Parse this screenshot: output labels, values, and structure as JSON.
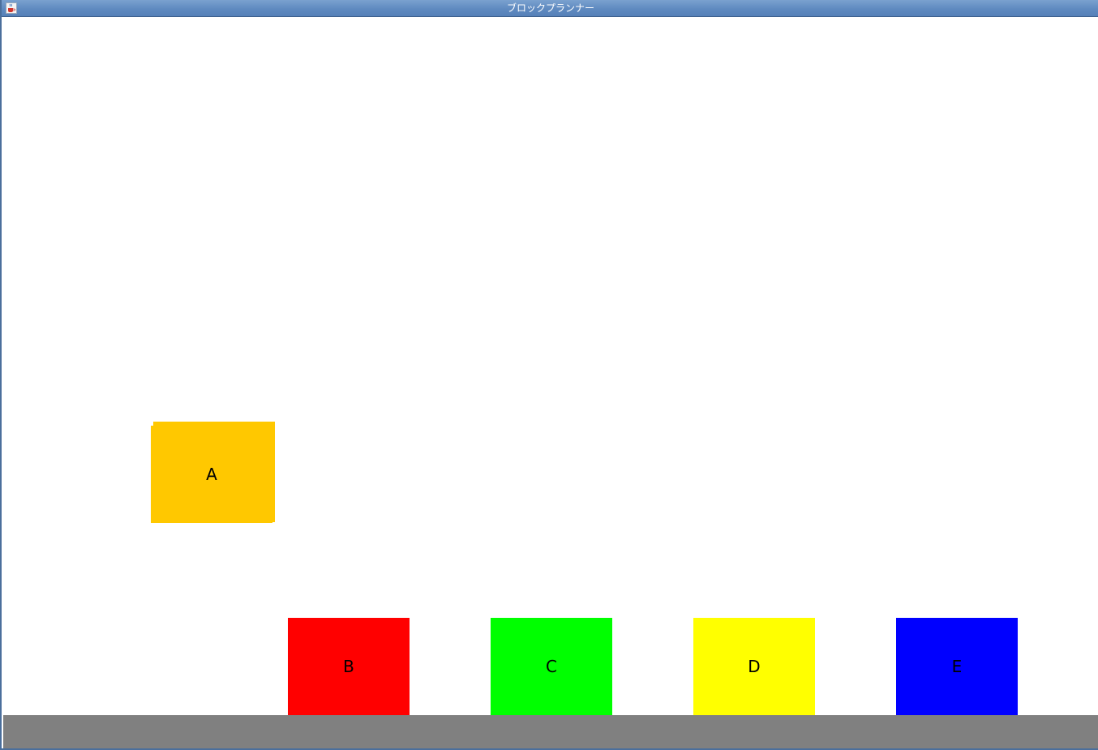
{
  "window": {
    "title": "ブロックプランナー",
    "icon": "java-cup-icon"
  },
  "colors": {
    "titlebar": "#5f8ac0",
    "background": "#ffffff",
    "floor": "#808080",
    "edge_line": "#cc00cc"
  },
  "blocks": [
    {
      "id": "A",
      "label": "A",
      "color": "#ffc800",
      "state": "held"
    },
    {
      "id": "B",
      "label": "B",
      "color": "#ff0000",
      "state": "on-floor"
    },
    {
      "id": "C",
      "label": "C",
      "color": "#00ff00",
      "state": "on-floor"
    },
    {
      "id": "D",
      "label": "D",
      "color": "#ffff00",
      "state": "on-floor"
    },
    {
      "id": "E",
      "label": "E",
      "color": "#0000ff",
      "state": "on-floor"
    }
  ]
}
